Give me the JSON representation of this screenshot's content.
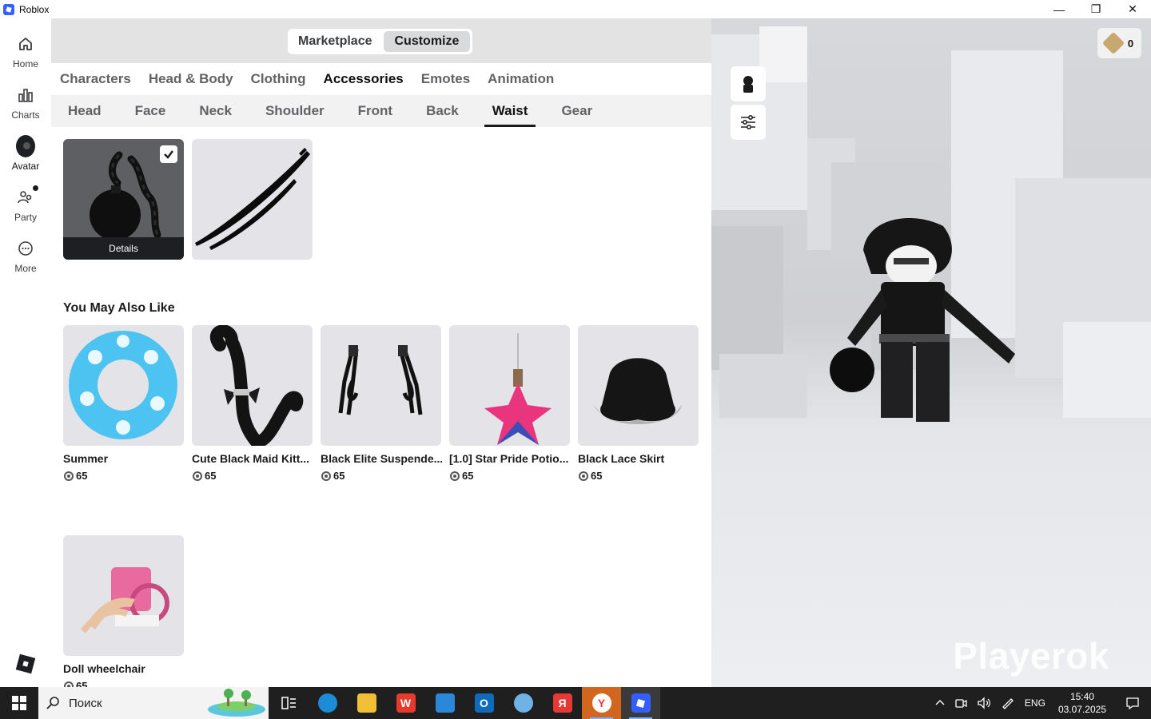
{
  "titlebar": {
    "title": "Roblox",
    "minimize": "—",
    "restore": "❐",
    "close": "✕"
  },
  "nav": {
    "items": [
      {
        "label": "Home",
        "icon": "home-icon"
      },
      {
        "label": "Charts",
        "icon": "charts-icon"
      },
      {
        "label": "Avatar",
        "icon": "avatar-icon",
        "active": true
      },
      {
        "label": "Party",
        "icon": "party-icon",
        "badge": true
      },
      {
        "label": "More",
        "icon": "more-icon"
      }
    ]
  },
  "segment": {
    "marketplace": "Marketplace",
    "customize": "Customize",
    "active": "Customize"
  },
  "categories": [
    "Characters",
    "Head & Body",
    "Clothing",
    "Accessories",
    "Emotes",
    "Animation"
  ],
  "active_category": "Accessories",
  "subcategories": [
    "Head",
    "Face",
    "Neck",
    "Shoulder",
    "Front",
    "Back",
    "Waist",
    "Gear"
  ],
  "active_subcategory": "Waist",
  "owned_items": [
    {
      "name": "ball-and-chain",
      "equipped": true,
      "details_label": "Details"
    },
    {
      "name": "twin-katanas",
      "equipped": false
    }
  ],
  "recommendations": {
    "title": "You May Also Like",
    "items": [
      {
        "name": "Summer",
        "price": "65"
      },
      {
        "name": "Cute Black Maid Kitt...",
        "price": "65"
      },
      {
        "name": "Black Elite Suspende...",
        "price": "65"
      },
      {
        "name": "[1.0] Star Pride Potio...",
        "price": "65"
      },
      {
        "name": "Black Lace Skirt",
        "price": "65"
      },
      {
        "name": "Doll wheelchair",
        "price": "65"
      }
    ]
  },
  "preview": {
    "robux_balance": "0",
    "watermark": "Playerok"
  },
  "taskbar": {
    "search_placeholder": "Поиск",
    "apps": [
      "task-view",
      "edge",
      "explorer",
      "wps",
      "store",
      "outlook",
      "paint",
      "yandex",
      "yandex-browser",
      "roblox"
    ],
    "language": "ENG",
    "time": "15:40",
    "date": "03.07.2025"
  }
}
